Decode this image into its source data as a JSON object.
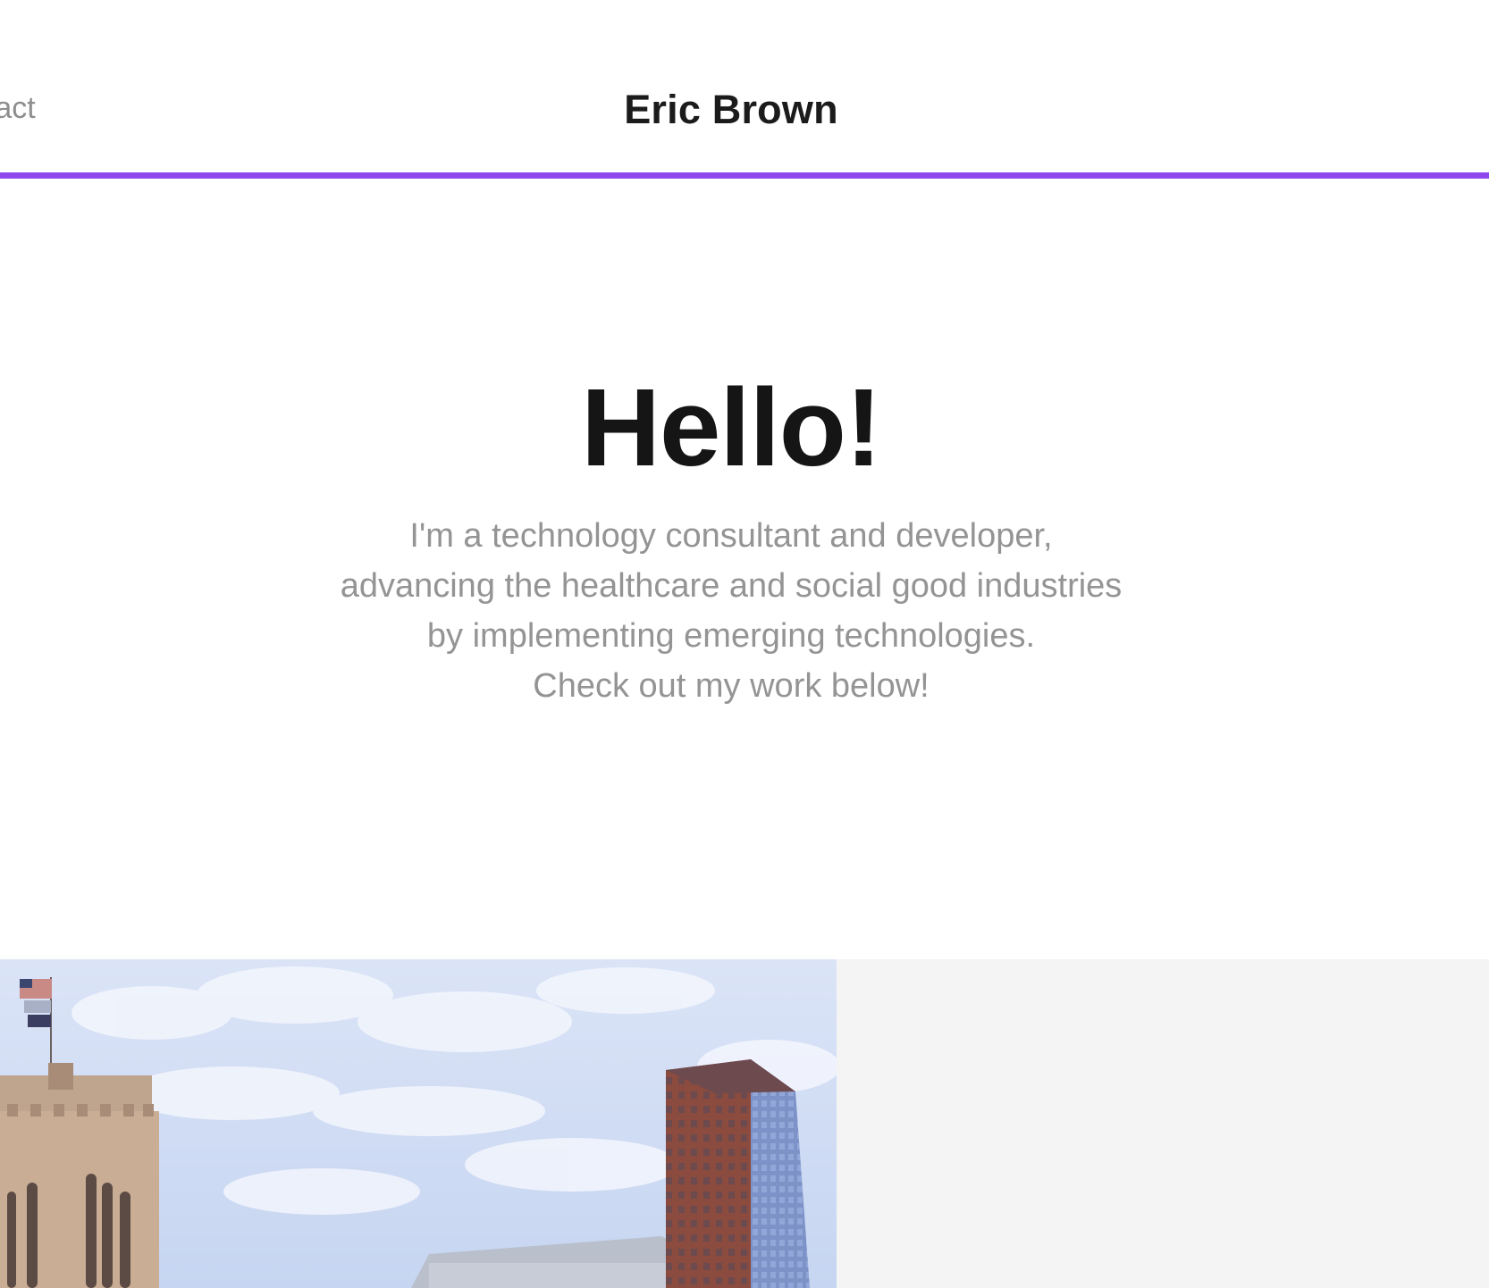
{
  "header": {
    "nav_partial_label": "ntact",
    "site_title": "Eric Brown",
    "accent_color": "#8f47ee"
  },
  "hero": {
    "heading": "Hello!",
    "lines": [
      "I'm a technology consultant and developer,",
      "advancing the healthcare and social good industries",
      "by implementing emerging technologies.",
      "Check out my work below!"
    ]
  },
  "portfolio": {
    "tile_image_icon": "city-buildings-photo",
    "tile_placeholder_color": "#f4f4f4"
  }
}
